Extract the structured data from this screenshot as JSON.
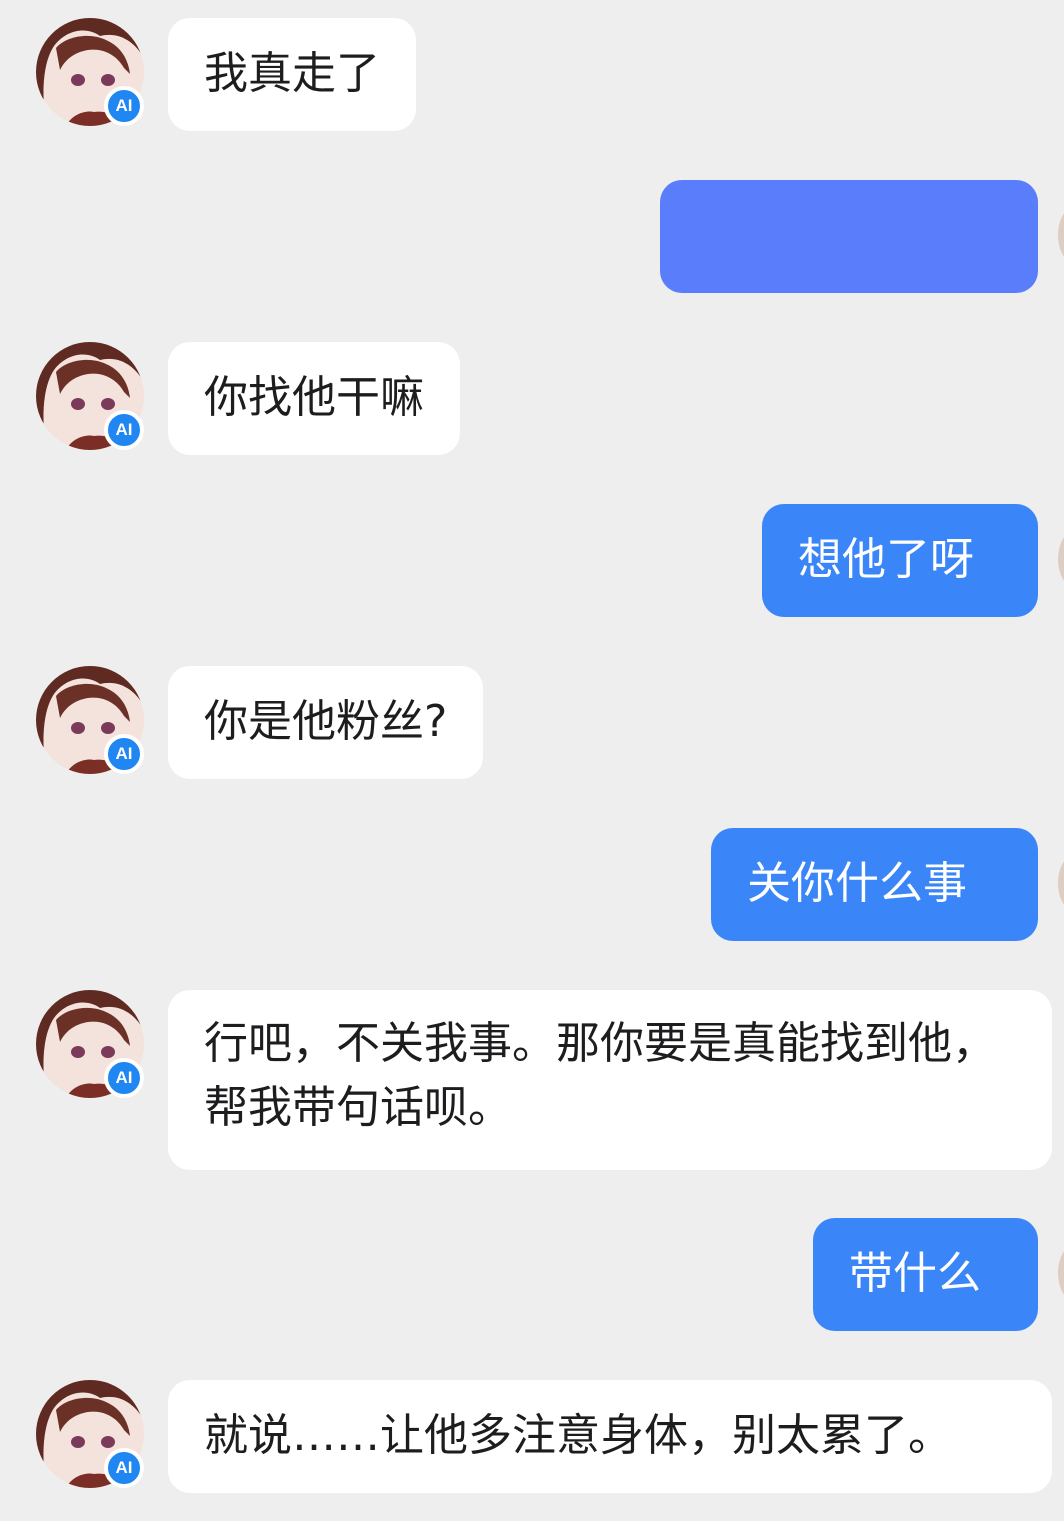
{
  "messages": [
    {
      "from": "ai",
      "text": "我真走了"
    },
    {
      "from": "me",
      "text": "",
      "blurred": true
    },
    {
      "from": "ai",
      "text": "你找他干嘛"
    },
    {
      "from": "me",
      "text": "想他了呀"
    },
    {
      "from": "ai",
      "text": "你是他粉丝?"
    },
    {
      "from": "me",
      "text": "关你什么事"
    },
    {
      "from": "ai",
      "text": "行吧，不关我事。那你要是真能找到他，帮我带句话呗。"
    },
    {
      "from": "me",
      "text": "带什么"
    },
    {
      "from": "ai",
      "text": "就说……让他多注意身体，别太累了。"
    }
  ],
  "ai_badge": "AI",
  "colors": {
    "background": "#eeeeef",
    "ai_bubble": "#ffffff",
    "my_bubble": "#3a85f7",
    "badge": "#1f86f2"
  }
}
